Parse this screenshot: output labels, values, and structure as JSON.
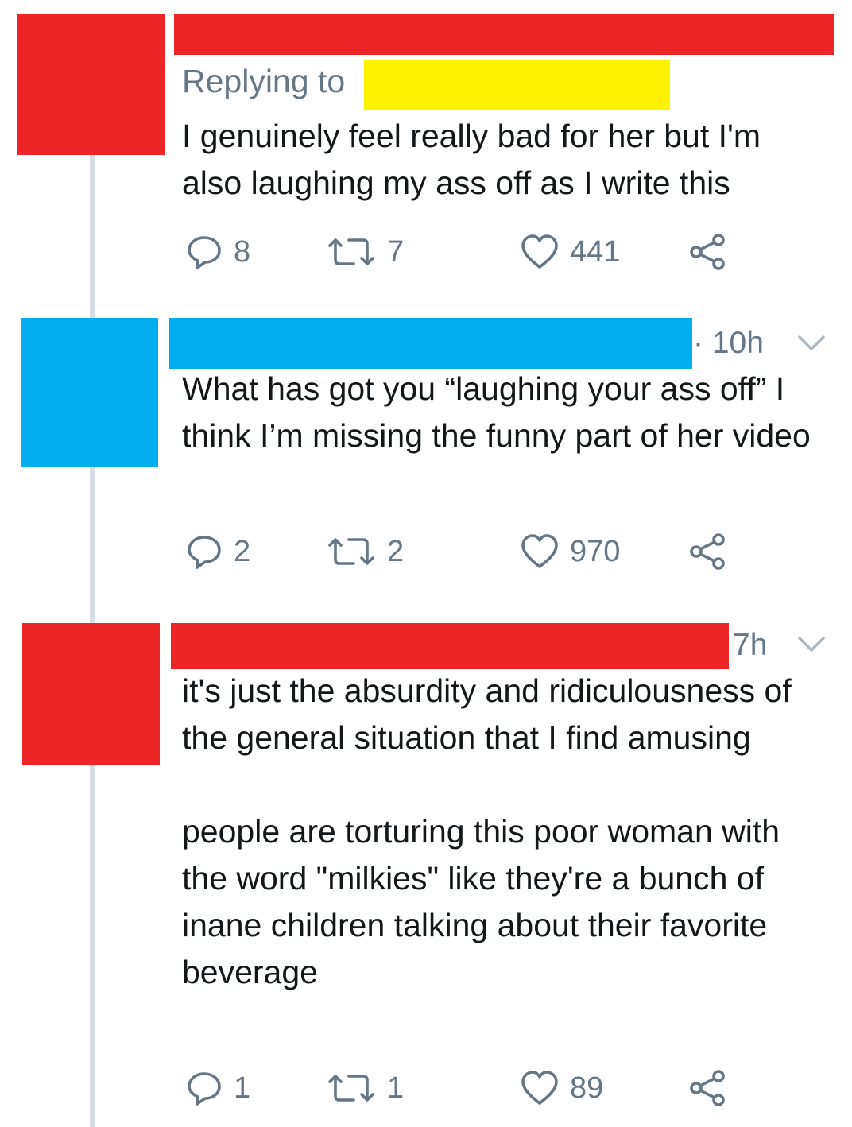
{
  "colors": {
    "redaction_red": "#ee2527",
    "redaction_yellow": "#fff200",
    "redaction_blue": "#00aeef",
    "thread_line": "#d6dde4",
    "text": "#14171a",
    "muted": "#657786"
  },
  "tweets": [
    {
      "replying_to_label": "Replying to",
      "text": "I genuinely feel really bad for her but I'm also laughing my ass off as I write this",
      "actions": {
        "replies": "8",
        "retweets": "7",
        "likes": "441"
      }
    },
    {
      "timestamp": "· 10h",
      "text": "What has got you “laughing your ass off” I think I’m missing the funny part of her video",
      "actions": {
        "replies": "2",
        "retweets": "2",
        "likes": "970"
      }
    },
    {
      "timestamp": "7h",
      "text": "it's just the absurdity and ridiculousness of the general situation that I find amusing\n\npeople are torturing this poor woman with the word \"milkies\" like they're a bunch of inane children talking about their favorite beverage",
      "actions": {
        "replies": "1",
        "retweets": "1",
        "likes": "89"
      }
    }
  ],
  "icons": {
    "reply": "reply-bubble-icon",
    "retweet": "retweet-arrows-icon",
    "like": "heart-icon",
    "share": "share-nodes-icon",
    "more": "chevron-down-icon"
  }
}
